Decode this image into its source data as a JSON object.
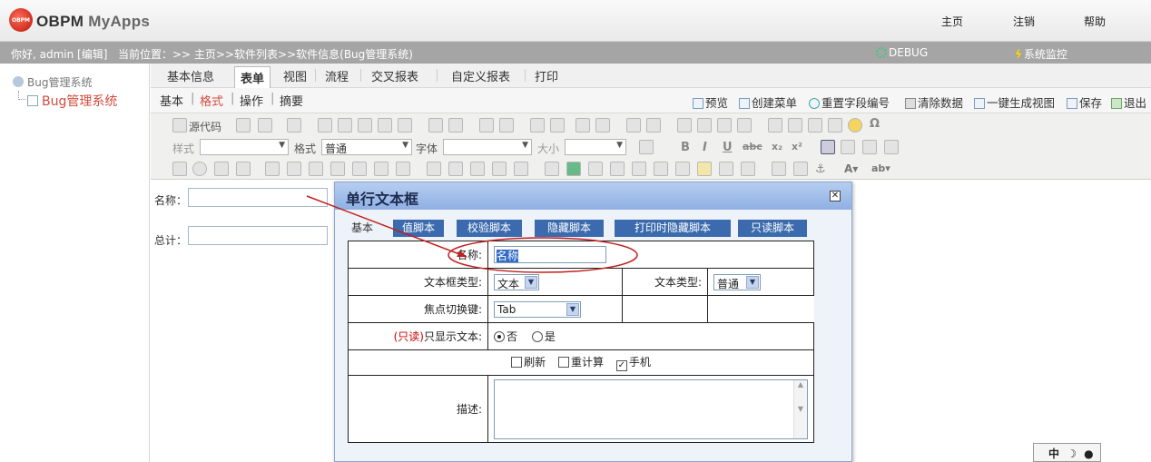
{
  "header": {
    "logo_mark": "OBPM",
    "logo_main": "OBPM",
    "logo_sub": "MyApps",
    "nav": [
      "主页",
      "注销",
      "帮助"
    ]
  },
  "statusbar": {
    "greeting": "你好, admin [编辑]",
    "location": "当前位置：>> 主页>>软件列表>>软件信息(Bug管理系统)",
    "debug": "DEBUG",
    "monitor": "系统监控"
  },
  "sidebar": {
    "root": "Bug管理系统",
    "child": "Bug管理系统"
  },
  "tabs": [
    "基本信息",
    "表单",
    "视图",
    "流程",
    "交叉报表",
    "自定义报表",
    "打印"
  ],
  "subtabs": [
    "基本",
    "格式",
    "操作",
    "摘要"
  ],
  "actions": [
    "预览",
    "创建菜单",
    "重置字段编号",
    "清除数据",
    "一键生成视图",
    "保存",
    "退出"
  ],
  "toolbar": {
    "source": "源代码",
    "style_label": "样式",
    "format_label": "格式",
    "format_value": "普通",
    "font_label": "字体",
    "size_label": "大小"
  },
  "form": {
    "name_label": "名称：",
    "total_label": "总计："
  },
  "dialog": {
    "title": "单行文本框",
    "tabs": [
      "基本",
      "值脚本",
      "校验脚本",
      "隐藏脚本",
      "打印时隐藏脚本",
      "只读脚本"
    ],
    "name_label": "名称:",
    "name_value": "名称",
    "textbox_type_label": "文本框类型:",
    "textbox_type_value": "文本",
    "text_type_label": "文本类型:",
    "text_type_value": "普通",
    "focus_label": "焦点切换键:",
    "focus_value": "Tab",
    "readonly_mark": "(只读)",
    "readonly_label": "只显示文本:",
    "radio_no": "否",
    "radio_yes": "是",
    "check_refresh": "刷新",
    "check_recalc": "重计算",
    "check_mobile": "手机",
    "desc_label": "描述:"
  },
  "ime": {
    "label": "中"
  },
  "colors": {
    "accent": "#d14b3b",
    "dialog_tab": "#3b6bae",
    "annotation": "#c21f1f"
  }
}
